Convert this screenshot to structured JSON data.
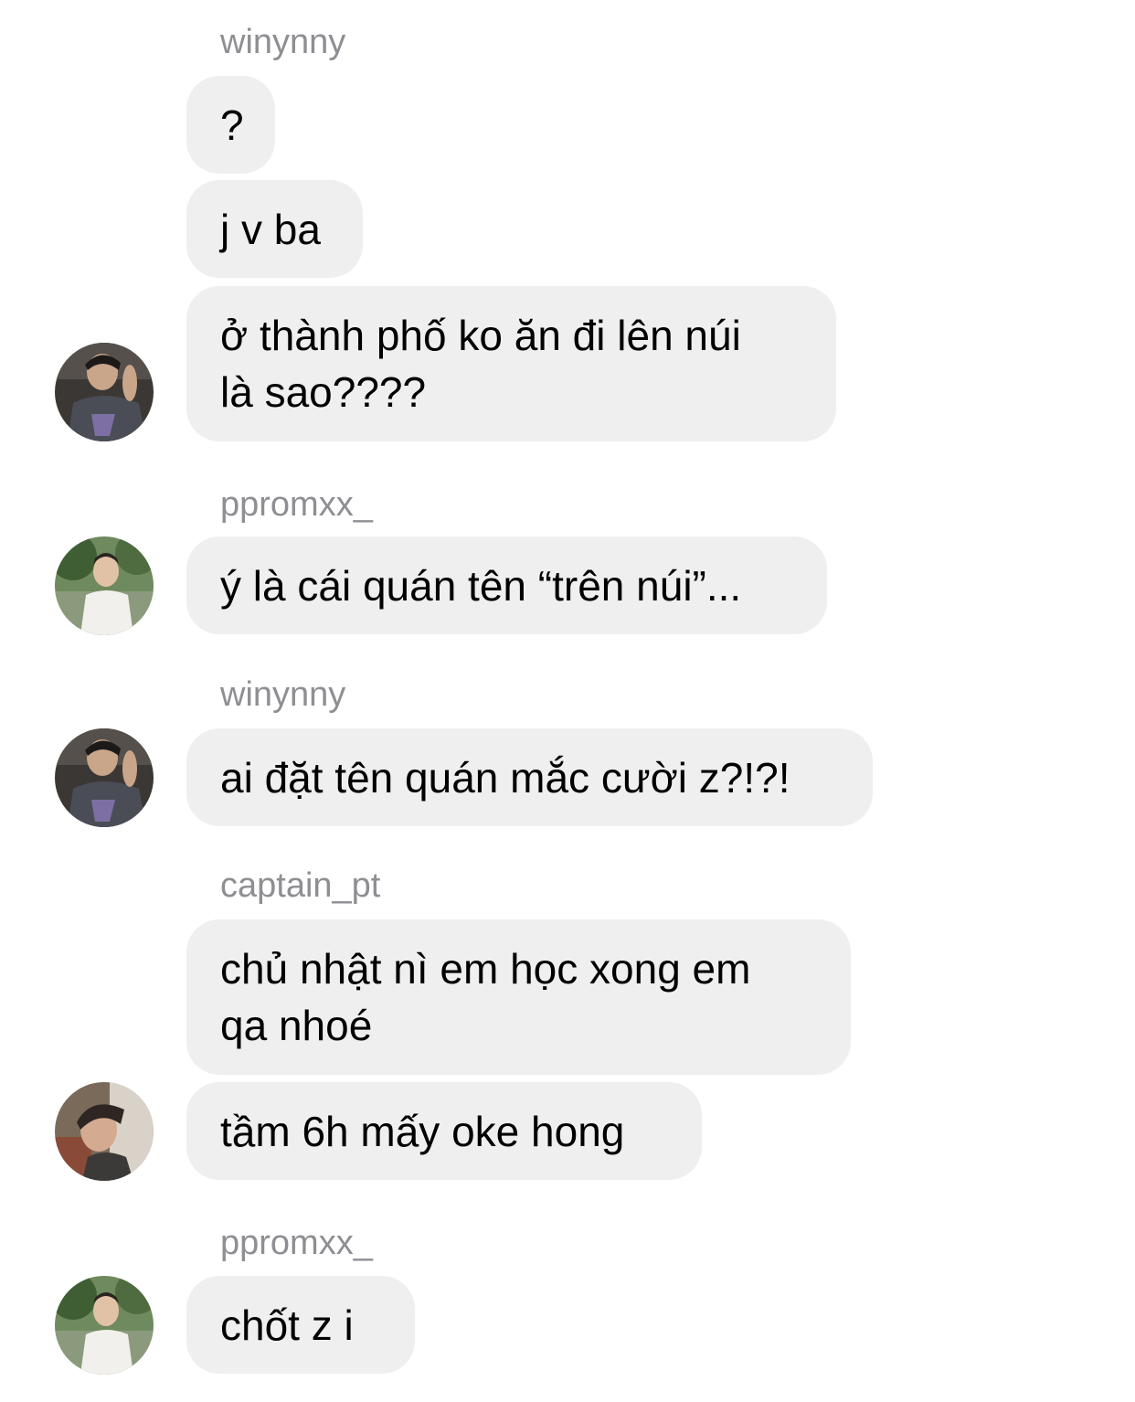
{
  "conversation": {
    "groups": [
      {
        "sender": "winynny",
        "messages": [
          "?",
          "j v ba",
          "ở thành phố ko ăn đi lên núi\nlà sao????"
        ],
        "avatar_icon": "user-avatar-winynny"
      },
      {
        "sender": "ppromxx_",
        "messages": [
          "ý là cái quán tên “trên núi”..."
        ],
        "avatar_icon": "user-avatar-ppromxx"
      },
      {
        "sender": "winynny",
        "messages": [
          "ai đặt tên quán mắc cười z?!?!"
        ],
        "avatar_icon": "user-avatar-winynny"
      },
      {
        "sender": "captain_pt",
        "messages": [
          "chủ nhật nì em học xong em\nqa nhoé",
          "tầm 6h mấy oke hong"
        ],
        "avatar_icon": "user-avatar-captain-pt"
      },
      {
        "sender": "ppromxx_",
        "messages": [
          "chốt z i"
        ],
        "avatar_icon": "user-avatar-ppromxx"
      }
    ]
  },
  "colors": {
    "bubble_background": "#efefef",
    "sender_name": "#8e8e93",
    "message_text": "#000000"
  }
}
